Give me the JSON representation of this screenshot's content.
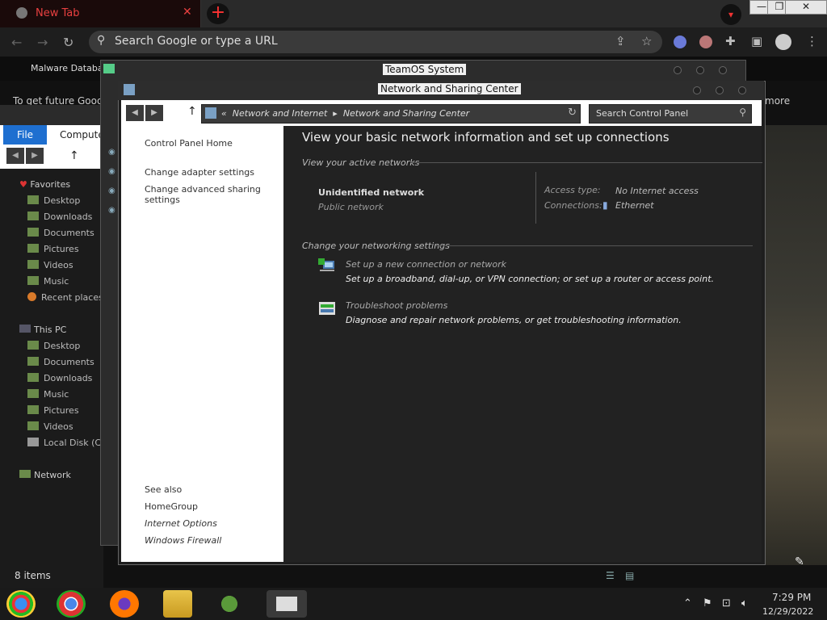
{
  "chrome": {
    "tab_title": "New Tab",
    "tab_close": "✕",
    "new_tab": "+",
    "omnibox_placeholder": "Search Google or type a URL",
    "bookmark": "Malware Databa",
    "info_text": "To get future Goog",
    "more_text": "more",
    "window_controls": [
      "—",
      "❐",
      "✕"
    ],
    "icons": [
      "back-icon",
      "forward-icon",
      "reload-icon",
      "search-icon",
      "share-icon",
      "star-icon",
      "extension-icon",
      "sidebar-icon",
      "profile-icon",
      "menu-icon"
    ]
  },
  "explorer": {
    "file_label": "File",
    "computer_tab": "Computer",
    "favorites_label": "Favorites",
    "favorites": [
      "Desktop",
      "Downloads",
      "Documents",
      "Pictures",
      "Videos",
      "Music",
      "Recent places"
    ],
    "thispc_label": "This PC",
    "thispc": [
      "Desktop",
      "Documents",
      "Downloads",
      "Music",
      "Pictures",
      "Videos",
      "Local Disk (C:"
    ],
    "network_label": "Network",
    "status": "8 items"
  },
  "teamos": {
    "title": "TeamOS System"
  },
  "nsc": {
    "title": "Network and Sharing Center",
    "breadcrumb": [
      "Network and Internet",
      "Network and Sharing Center"
    ],
    "search_placeholder": "Search Control Panel",
    "left_links": [
      "Control Panel Home",
      "Change adapter settings",
      "Change advanced sharing settings"
    ],
    "see_also_label": "See also",
    "see_also": [
      "HomeGroup",
      "Internet Options",
      "Windows Firewall"
    ],
    "heading": "View your basic network information and set up connections",
    "active_networks_label": "View your active networks",
    "network_name": "Unidentified network",
    "network_type": "Public network",
    "access_type_label": "Access type:",
    "access_type_value": "No Internet access",
    "connections_label": "Connections:",
    "connections_value": "Ethernet",
    "change_settings_label": "Change your networking settings",
    "tasks": [
      {
        "link": "Set up a new connection or network",
        "desc": "Set up a broadband, dial-up, or VPN connection; or set up a router or access point."
      },
      {
        "link": "Troubleshoot problems",
        "desc": "Diagnose and repair network problems, or get troubleshooting information."
      }
    ]
  },
  "taskbar": {
    "time": "7:29 PM",
    "date": "12/29/2022",
    "apps": [
      "start-icon",
      "chrome-icon",
      "firefox-icon",
      "file-explorer-icon",
      "people-icon",
      "control-panel-icon"
    ],
    "tray": [
      "chevron-up-icon",
      "flag-icon",
      "network-icon",
      "volume-icon"
    ]
  },
  "colors": {
    "accent": "#1e6fd0",
    "tab_text": "#e84040",
    "window_bg": "#1e1e1e"
  }
}
